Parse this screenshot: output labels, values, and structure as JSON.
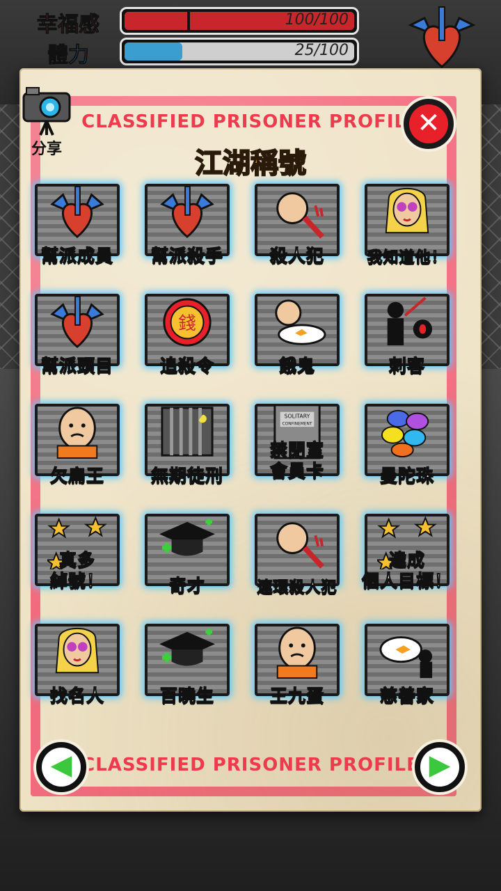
{
  "stats": [
    {
      "label": "幸福感",
      "value_text": "100/100",
      "fill": 1.0,
      "label_color": "#d23a2a",
      "fill_color": "#c8262a"
    },
    {
      "label": "體力",
      "value_text": "25/100",
      "fill": 0.25,
      "label_color": "#2a9ad8",
      "fill_color": "#3a9fd0"
    }
  ],
  "panel": {
    "header": "CLASSIFIED PRISONER PROFILE",
    "footer": "CLASSIFIED PRISONER PROFILE",
    "heading": "江湖稱號",
    "share_label": "分享",
    "close_icon": "✕",
    "prev_icon": "◀",
    "next_icon": "▶"
  },
  "titles": [
    {
      "label": "幫派成員",
      "icon": "winged-heart-icon",
      "color": "white"
    },
    {
      "label": "幫派殺手",
      "icon": "winged-heart-icon",
      "color": "white"
    },
    {
      "label": "殺人犯",
      "icon": "fist-knife-icon",
      "color": "white"
    },
    {
      "label": "我知道他！",
      "icon": "celebrity-icon",
      "color": "white"
    },
    {
      "label": "幫派頭目",
      "icon": "winged-heart-icon",
      "color": "white"
    },
    {
      "label": "追殺令",
      "icon": "money-medal-icon",
      "color": "orange"
    },
    {
      "label": "餓鬼",
      "icon": "fist-plate-icon",
      "color": "white"
    },
    {
      "label": "刺客",
      "icon": "assassin-icon",
      "color": "white"
    },
    {
      "label": "欠扁王",
      "icon": "bald-prisoner-icon",
      "color": "white"
    },
    {
      "label": "無期徒刑",
      "icon": "jail-cell-icon",
      "color": "orange"
    },
    {
      "label": "禁閉室\n會員卡",
      "icon": "solitary-door-icon",
      "color": "white"
    },
    {
      "label": "曼陀珠",
      "icon": "candy-icon",
      "color": "white"
    },
    {
      "label": "真多\n綽號！",
      "icon": "stars-icon",
      "color": "white"
    },
    {
      "label": "奇才",
      "icon": "graduation-cap-icon",
      "color": "white"
    },
    {
      "label": "連環殺人犯",
      "icon": "fist-knife-icon",
      "color": "white"
    },
    {
      "label": "達成\n個人目標！",
      "icon": "stars-icon",
      "color": "white"
    },
    {
      "label": "找名人",
      "icon": "celebrity-icon",
      "color": "white"
    },
    {
      "label": "百曉生",
      "icon": "graduation-cap-icon",
      "color": "white"
    },
    {
      "label": "王九蛋",
      "icon": "bald-prisoner-icon",
      "color": "white"
    },
    {
      "label": "慈善家",
      "icon": "plate-give-icon",
      "color": "white"
    }
  ],
  "solitary_sign": "SOLITARY\nCONFINEMENT",
  "medal_char": "錢"
}
